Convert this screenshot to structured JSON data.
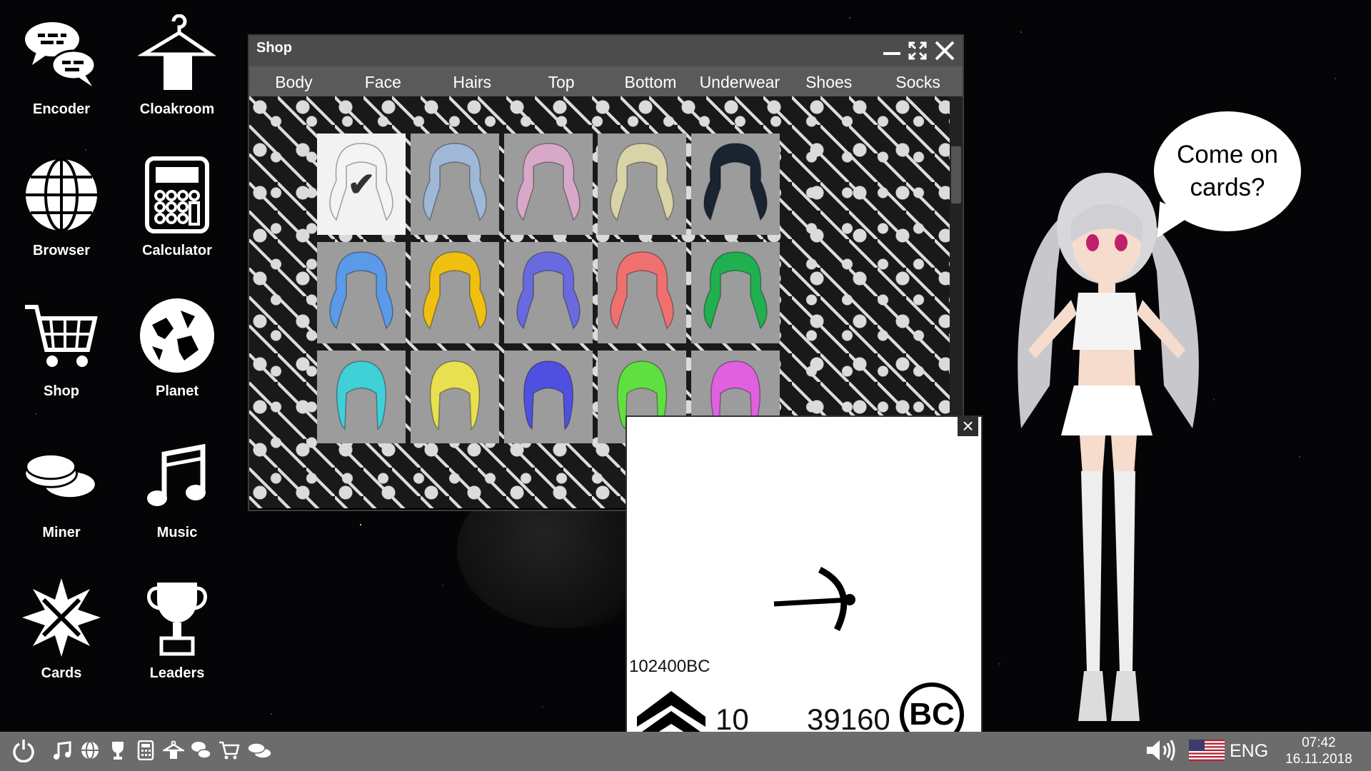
{
  "desktop": {
    "icons": [
      {
        "label": "Encoder"
      },
      {
        "label": "Cloakroom"
      },
      {
        "label": "Browser"
      },
      {
        "label": "Calculator"
      },
      {
        "label": "Shop"
      },
      {
        "label": "Planet"
      },
      {
        "label": "Miner"
      },
      {
        "label": "Music"
      },
      {
        "label": "Cards"
      },
      {
        "label": "Leaders"
      }
    ]
  },
  "shop_window": {
    "title": "Shop",
    "tabs": [
      {
        "label": "Body"
      },
      {
        "label": "Face"
      },
      {
        "label": "Hairs"
      },
      {
        "label": "Top"
      },
      {
        "label": "Bottom"
      },
      {
        "label": "Underwear"
      },
      {
        "label": "Shoes"
      },
      {
        "label": "Socks"
      }
    ],
    "hair_items": {
      "row_top_partial": [
        "#2f8a2f",
        "#5a4e5e",
        "#c0102a",
        "#d020c0",
        "#e0c020"
      ],
      "row_1": [
        "#f4f4f4",
        "#9fb8d8",
        "#d8a8c8",
        "#d8d4a8",
        "#1a2430"
      ],
      "row_2": [
        "#5a9ae8",
        "#f0c010",
        "#6a6ae0",
        "#f07070",
        "#20b050"
      ],
      "row_3": [
        "#40d0d8",
        "#e8e050",
        "#5050e0",
        "#60e040",
        "#e060e0"
      ],
      "selected_index": 0
    }
  },
  "miner_window": {
    "address": "102400BC",
    "level": "10",
    "coins": "39160",
    "currency_badge": "BC"
  },
  "assistant": {
    "speech": "Come on cards?"
  },
  "taskbar": {
    "language": "ENG",
    "time": "07:42",
    "date": "16.11.2018"
  }
}
